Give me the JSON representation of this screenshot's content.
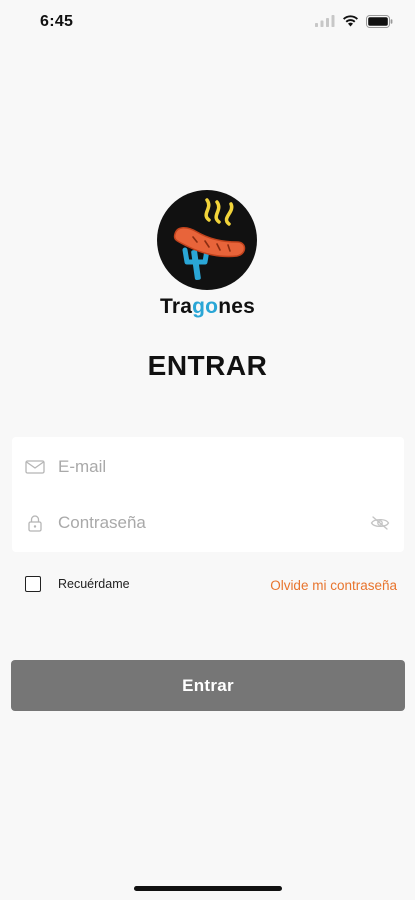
{
  "status_bar": {
    "time": "6:45"
  },
  "brand": {
    "name_part1": "Tra",
    "name_accent": "go",
    "name_part2": "nes",
    "accent_color": "#2aa6d6"
  },
  "page": {
    "title": "ENTRAR"
  },
  "form": {
    "email": {
      "placeholder": "E-mail",
      "value": ""
    },
    "password": {
      "placeholder": "Contraseña",
      "value": ""
    },
    "remember_label": "Recuérdame",
    "remember_checked": false,
    "forgot_label": "Olvide mi contraseña",
    "submit_label": "Entrar"
  },
  "colors": {
    "background": "#f8f8f8",
    "button": "#767676",
    "link": "#e8742d",
    "logo_sausage": "#e8643a",
    "logo_fork": "#2aa6d6",
    "logo_smoke": "#f2d43a"
  },
  "icons": [
    "signal-icon",
    "wifi-icon",
    "battery-icon",
    "envelope-icon",
    "lock-icon",
    "eye-off-icon"
  ]
}
